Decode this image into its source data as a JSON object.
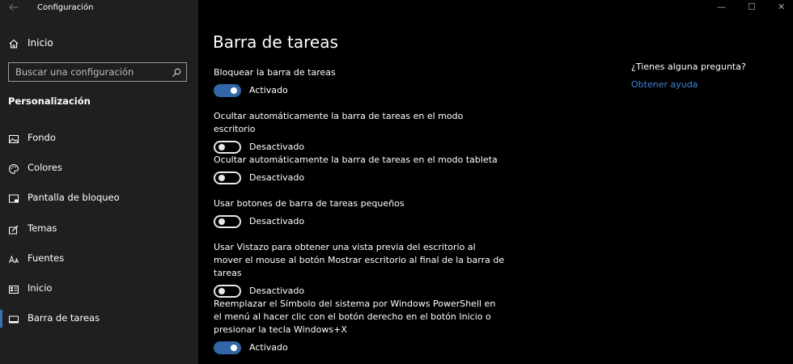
{
  "window": {
    "title": "Configuración",
    "controls": {
      "minimize": "—",
      "maximize": "☐",
      "close": "✕"
    }
  },
  "sidebar": {
    "home_label": "Inicio",
    "search_placeholder": "Buscar una configuración",
    "section_title": "Personalización",
    "items": [
      {
        "label": "Fondo",
        "icon": "picture-icon"
      },
      {
        "label": "Colores",
        "icon": "palette-icon"
      },
      {
        "label": "Pantalla de bloqueo",
        "icon": "lock-screen-icon"
      },
      {
        "label": "Temas",
        "icon": "brush-icon"
      },
      {
        "label": "Fuentes",
        "icon": "font-icon"
      },
      {
        "label": "Inicio",
        "icon": "start-icon"
      },
      {
        "label": "Barra de tareas",
        "icon": "taskbar-icon",
        "selected": true
      }
    ]
  },
  "main": {
    "title": "Barra de tareas",
    "settings": [
      {
        "label": "Bloquear la barra de tareas",
        "state": "Activado",
        "on": true
      },
      {
        "label": "Ocultar automáticamente la barra de tareas en el modo escritorio",
        "state": "Desactivado",
        "on": false
      },
      {
        "label": "Ocultar automáticamente la barra de tareas en el modo tableta",
        "state": "Desactivado",
        "on": false
      },
      {
        "label": "Usar botones de barra de tareas pequeños",
        "state": "Desactivado",
        "on": false
      },
      {
        "label": "Usar Vistazo para obtener una vista previa del escritorio al mover el mouse al botón Mostrar escritorio al final de la barra de tareas",
        "state": "Desactivado",
        "on": false
      },
      {
        "label": "Reemplazar el Símbolo del sistema por Windows PowerShell en el menú al hacer clic con el botón derecho en el botón Inicio o presionar la tecla Windows+X",
        "state": "Activado",
        "on": true
      }
    ]
  },
  "help": {
    "question": "¿Tienes alguna pregunta?",
    "link": "Obtener ayuda"
  },
  "colors": {
    "sidebar_bg": "#1f1f1f",
    "main_bg": "#000000",
    "accent": "#3266a8",
    "link": "#3f84d8"
  }
}
